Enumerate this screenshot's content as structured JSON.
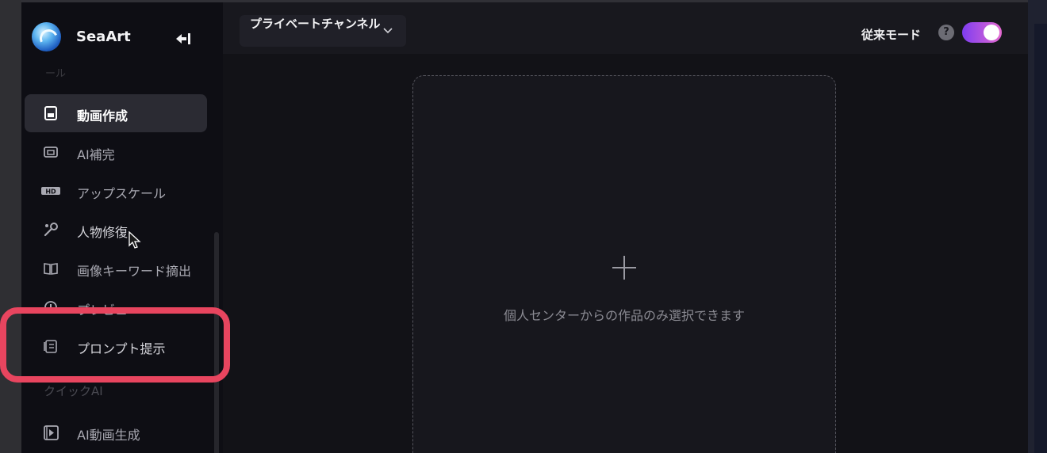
{
  "sidebar": {
    "brand": "SeaArt",
    "faded_top": "ール",
    "items": [
      {
        "label": "動画作成",
        "icon": "video-edit-icon",
        "active": true
      },
      {
        "label": "AI補完",
        "icon": "image-fill-icon"
      },
      {
        "label": "アップスケール",
        "icon": "hd-upscale-icon"
      },
      {
        "label": "人物修復",
        "icon": "wrench-repair-icon"
      },
      {
        "label": "画像キーワード摘出",
        "icon": "book-keyword-icon"
      },
      {
        "label": "プレビュー",
        "icon": "preview-icon"
      },
      {
        "label": "プロンプト提示",
        "icon": "prompt-notes-icon"
      },
      {
        "label": "AI動画生成",
        "icon": "video-play-icon"
      }
    ],
    "section_title": "クイックAI"
  },
  "header": {
    "channel": "プライベートチャンネル",
    "mode_label": "従来モード",
    "help": "?",
    "toggle_on": true
  },
  "main": {
    "upload_hint": "個人センターからの作品のみ選択できます"
  },
  "colors": {
    "accent_gradient_start": "#7e3df0",
    "accent_gradient_end": "#e56ad1",
    "highlight": "#e8455f"
  }
}
